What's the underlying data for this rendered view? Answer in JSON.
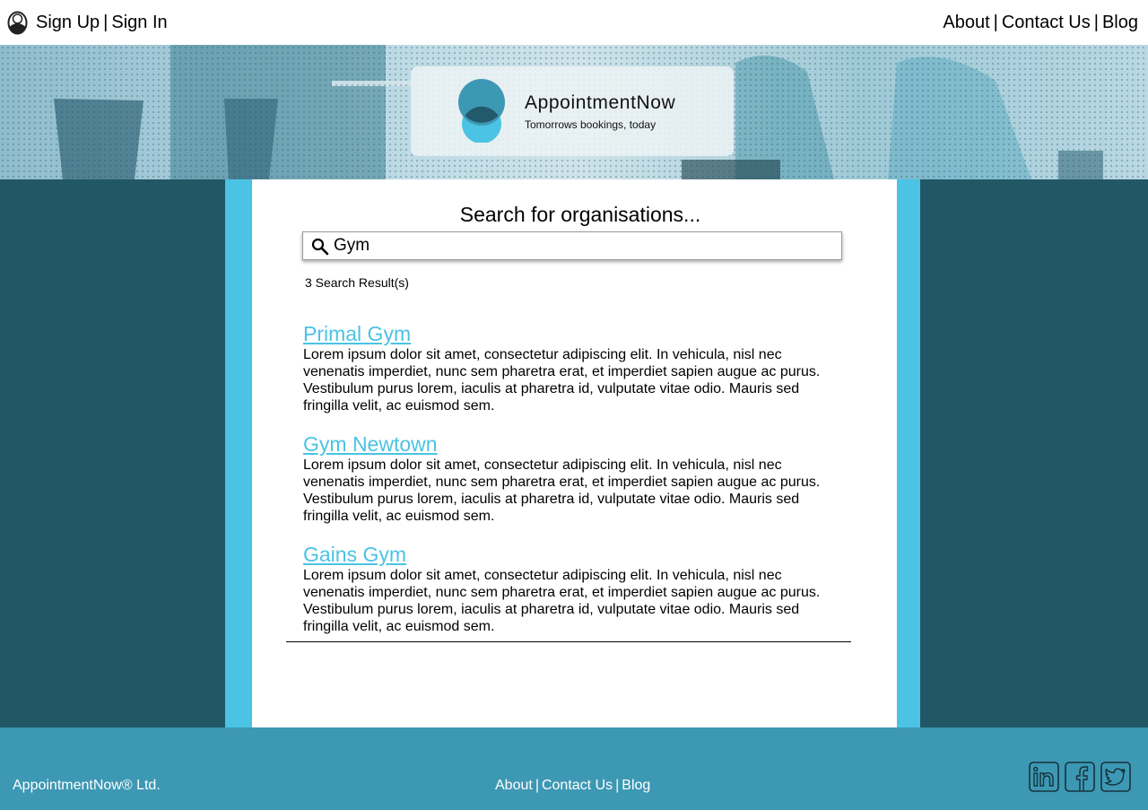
{
  "header": {
    "sign_up": "Sign Up",
    "separator": "|",
    "sign_in": "Sign In",
    "nav": [
      "About",
      "Contact Us",
      "Blog"
    ]
  },
  "brand": {
    "name": "AppointmentNow",
    "tagline": "Tomorrows bookings, today"
  },
  "search": {
    "title": "Search for organisations...",
    "value": "Gym",
    "result_count": "3 Search Result(s)"
  },
  "results": [
    {
      "title": "Primal Gym",
      "description": "Lorem ipsum dolor sit amet, consectetur adipiscing elit. In vehicula, nisl nec venenatis imperdiet, nunc sem pharetra erat, et imperdiet sapien augue ac purus. Vestibulum purus lorem, iaculis at pharetra id, vulputate vitae odio. Mauris sed fringilla velit, ac euismod sem."
    },
    {
      "title": "Gym Newtown",
      "description": "Lorem ipsum dolor sit amet, consectetur adipiscing elit. In vehicula, nisl nec venenatis imperdiet, nunc sem pharetra erat, et imperdiet sapien augue ac purus. Vestibulum purus lorem, iaculis at pharetra id, vulputate vitae odio. Mauris sed fringilla velit, ac euismod sem."
    },
    {
      "title": "Gains Gym",
      "description": "Lorem ipsum dolor sit amet, consectetur adipiscing elit. In vehicula, nisl nec venenatis imperdiet, nunc sem pharetra erat, et imperdiet sapien augue ac purus. Vestibulum purus lorem, iaculis at pharetra id, vulputate vitae odio. Mauris sed fringilla velit, ac euismod sem."
    }
  ],
  "footer": {
    "copyright": "AppointmentNow® Ltd.",
    "links": [
      "About",
      "Contact Us",
      "Blog"
    ],
    "social_icons": [
      "linkedin-icon",
      "facebook-icon",
      "twitter-icon"
    ]
  },
  "colors": {
    "page_background": "#225766",
    "accent": "#4bc3e4",
    "footer": "#3d98b4",
    "logo_dark": "#235a6b",
    "logo_mid": "#3d98b4",
    "logo_light": "#4bc3e4"
  }
}
